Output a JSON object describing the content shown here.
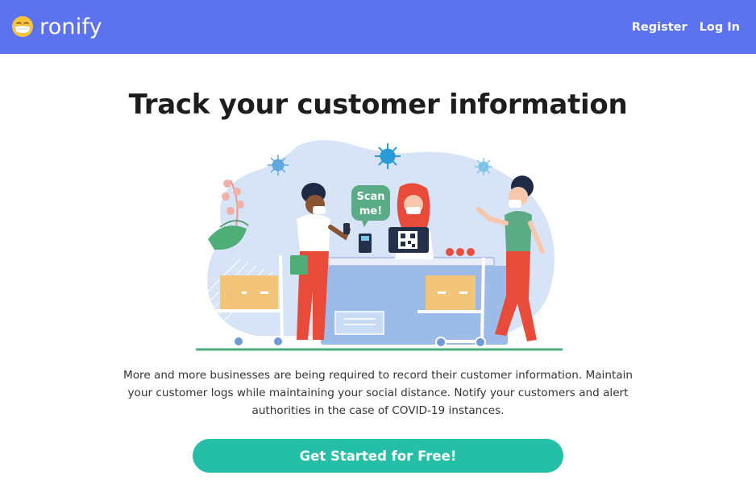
{
  "navbar": {
    "brand_name": "ronify",
    "brand_icon": "masked-face-emoji-icon",
    "links": [
      {
        "label": "Register"
      },
      {
        "label": "Log In"
      }
    ],
    "background_color": "#5c73f0"
  },
  "hero": {
    "title": "Track your customer information",
    "illustration": {
      "speech_bubble_text": "Scan me!"
    },
    "description": "More and more businesses are being required to record their customer information. Maintain your customer logs while maintaining your social distance. Notify your customers and alert authorities in the case of COVID-19 instances.",
    "cta_label": "Get Started for Free!",
    "cta_color": "#24bfa6"
  }
}
